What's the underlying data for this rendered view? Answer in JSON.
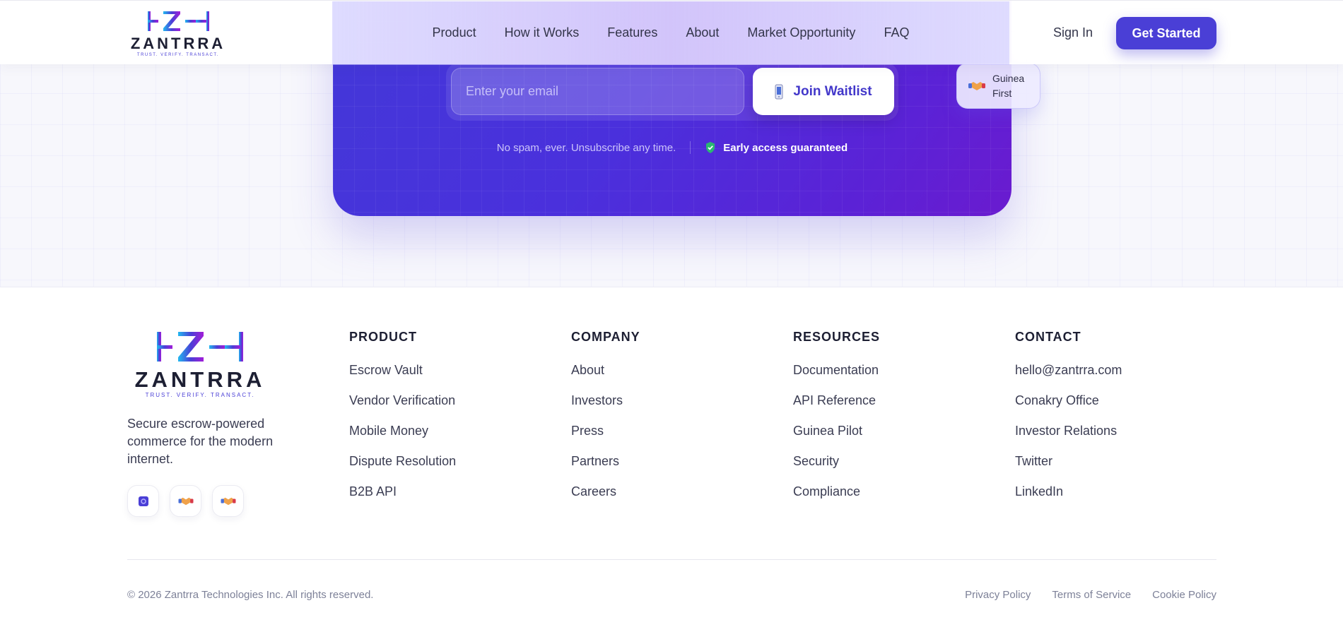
{
  "brand": {
    "name": "ZANTRRA",
    "tagline_small": "TRUST. VERIFY. TRANSACT.",
    "colors": {
      "primary": "#4a3fd6",
      "gradient_start": "#22b8f0",
      "gradient_end": "#a21cd8"
    }
  },
  "header": {
    "nav": [
      "Product",
      "How it Works",
      "Features",
      "About",
      "Market Opportunity",
      "FAQ"
    ],
    "sign_in": "Sign In",
    "get_started": "Get Started"
  },
  "waitlist": {
    "email_placeholder": "Enter your email",
    "join_label": "Join Waitlist",
    "no_spam": "No spam, ever. Unsubscribe any time.",
    "early_access": "Early access guaranteed",
    "badge": "Guinea First"
  },
  "footer": {
    "tagline": "Secure escrow-powered commerce for the modern internet.",
    "socials": [
      "vault-icon",
      "handshake-icon",
      "handshake-icon"
    ],
    "columns": [
      {
        "title": "PRODUCT",
        "links": [
          "Escrow Vault",
          "Vendor Verification",
          "Mobile Money",
          "Dispute Resolution",
          "B2B API"
        ]
      },
      {
        "title": "COMPANY",
        "links": [
          "About",
          "Investors",
          "Press",
          "Partners",
          "Careers"
        ]
      },
      {
        "title": "RESOURCES",
        "links": [
          "Documentation",
          "API Reference",
          "Guinea Pilot",
          "Security",
          "Compliance"
        ]
      },
      {
        "title": "CONTACT",
        "links": [
          "hello@zantrra.com",
          "Conakry Office",
          "Investor Relations",
          "Twitter",
          "LinkedIn"
        ]
      }
    ],
    "copyright": "© 2026 Zantrra Technologies Inc. All rights reserved.",
    "legal": [
      "Privacy Policy",
      "Terms of Service",
      "Cookie Policy"
    ]
  }
}
